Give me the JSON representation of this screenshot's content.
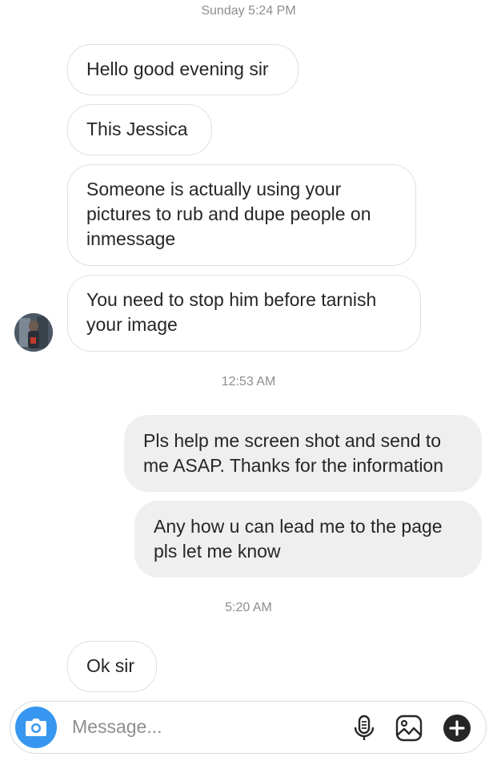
{
  "timestamps": {
    "first": "Sunday 5:24 PM",
    "second": "12:53 AM",
    "third": "5:20 AM"
  },
  "messages": [
    {
      "from": "them",
      "text": "Hello good evening sir"
    },
    {
      "from": "them",
      "text": "This Jessica"
    },
    {
      "from": "them",
      "text": "Someone is actually using your pictures to rub and dupe people on inmessage"
    },
    {
      "from": "them",
      "text": "You need to stop him before tarnish your image"
    },
    {
      "from": "me",
      "text": "Pls help me screen shot and send to me ASAP. Thanks for the information"
    },
    {
      "from": "me",
      "text": "Any how u can lead me to the page pls let me know"
    },
    {
      "from": "them",
      "text": "Ok sir"
    }
  ],
  "composer": {
    "placeholder": "Message...",
    "icons": [
      "camera-icon",
      "microphone-icon",
      "gallery-icon",
      "plus-icon"
    ]
  },
  "colors": {
    "accent": "#3797f0",
    "outgoing_bubble": "#efefef",
    "timestamp": "#8e8e8e"
  }
}
